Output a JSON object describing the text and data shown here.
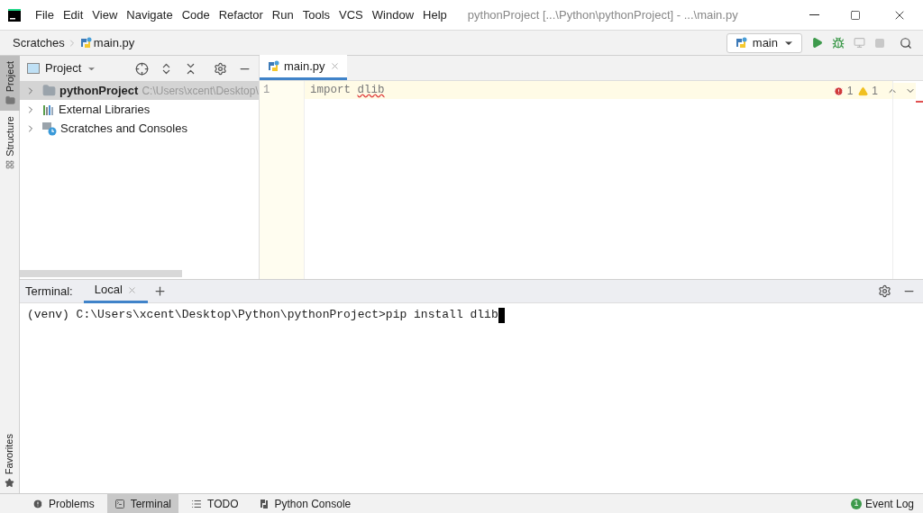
{
  "menu_bar": {
    "items": [
      "File",
      "Edit",
      "View",
      "Navigate",
      "Code",
      "Refactor",
      "Run",
      "Tools",
      "VCS",
      "Window",
      "Help"
    ],
    "title": "pythonProject [...\\Python\\pythonProject] - ...\\main.py"
  },
  "navigation_bar": {
    "breadcrumbs": [
      "Scratches",
      "main.py"
    ],
    "run_config": "main"
  },
  "left_stripe": [
    {
      "label": "Project",
      "selected": true
    },
    {
      "label": "Structure",
      "selected": false
    }
  ],
  "favorites": {
    "label": "Favorites"
  },
  "project_panel": {
    "title": "Project",
    "tree": [
      {
        "label": "pythonProject",
        "path": "C:\\Users\\xcent\\Desktop\\",
        "kind": "folder",
        "selected": true
      },
      {
        "label": "External Libraries",
        "kind": "library",
        "selected": false
      },
      {
        "label": "Scratches and Consoles",
        "kind": "scratches",
        "selected": false
      }
    ]
  },
  "editor": {
    "tabs": [
      {
        "label": "main.py",
        "selected": true
      }
    ],
    "lines": [
      {
        "number": "1",
        "keyword": "import",
        "rest": "dlib"
      }
    ],
    "errors": "1",
    "warnings": "1"
  },
  "terminal": {
    "title": "Terminal:",
    "tabs": [
      {
        "label": "Local",
        "selected": true
      }
    ],
    "lines": [
      "(venv) C:\\Users\\xcent\\Desktop\\Python\\pythonProject>pip install dlib"
    ]
  },
  "bottom_bar": {
    "tools": [
      {
        "label": "Problems",
        "kind": "problems",
        "selected": false
      },
      {
        "label": "Terminal",
        "kind": "terminal",
        "selected": true
      },
      {
        "label": "TODO",
        "kind": "todo",
        "selected": false
      },
      {
        "label": "Python Console",
        "kind": "console",
        "selected": false
      }
    ],
    "event_log": {
      "label": "Event Log",
      "count": "1"
    }
  }
}
